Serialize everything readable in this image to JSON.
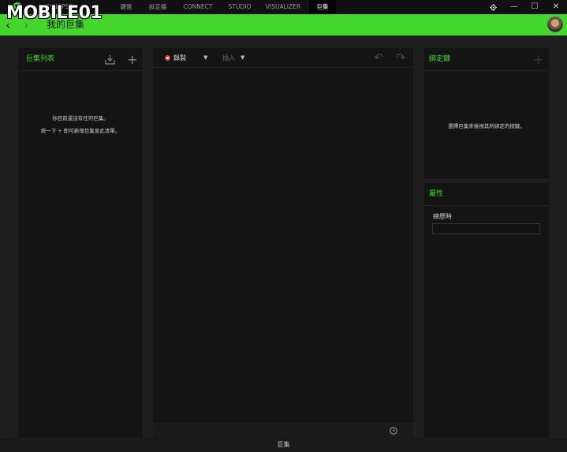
{
  "watermark": "MOBILE01",
  "nav": {
    "tabs": [
      "SYNAPSE",
      "",
      "鍵盤",
      "設定檔",
      "CONNECT",
      "STUDIO",
      "VISUALIZER",
      "巨集"
    ],
    "active_tab": "巨集"
  },
  "window_controls": {
    "settings_icon": "gear-icon",
    "minimize": "—",
    "maximize": "☐",
    "close": "✕"
  },
  "header": {
    "back": "‹",
    "forward": "›",
    "title": "我的巨集"
  },
  "macro_list": {
    "title": "巨集列表",
    "import_icon": "import-icon",
    "add": "+",
    "empty_line1": "你目前還沒有任何巨集。",
    "empty_line2": "按一下 + 即可新增巨集至此清單。"
  },
  "editor": {
    "record_label": "錄製",
    "insert_label": "插入",
    "undo": "↶",
    "redo": "↷",
    "history_icon": "clock-icon"
  },
  "bindings": {
    "title": "綁定鍵",
    "add": "+",
    "message": "選擇巨集來檢視其所綁定的按鍵。"
  },
  "properties": {
    "title": "屬性",
    "total_time_label": "總歷時",
    "total_time_value": ""
  },
  "status_bar": {
    "text": "巨集"
  },
  "colors": {
    "accent": "#44d62c",
    "record": "#e04646",
    "panel": "#141414",
    "background": "#1e1e1e"
  }
}
